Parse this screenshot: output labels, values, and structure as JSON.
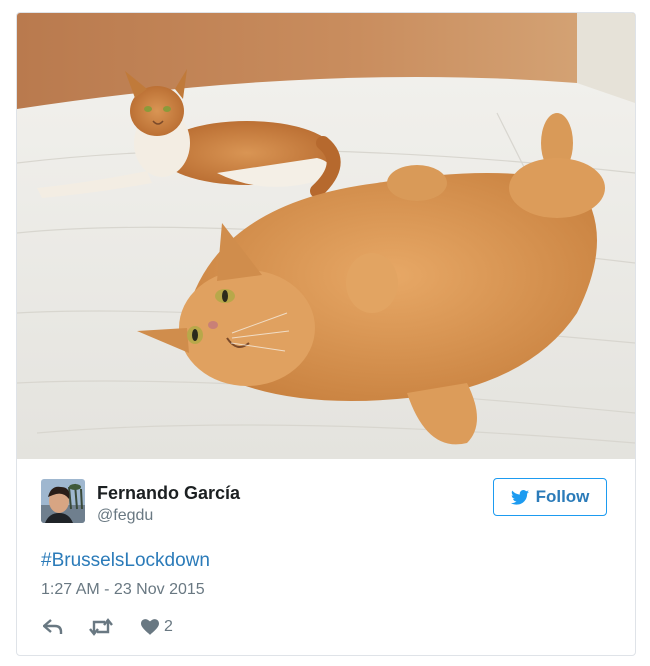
{
  "photo": {
    "subject": "two orange tabby cats lying on a white bed"
  },
  "author": {
    "name": "Fernando García",
    "handle": "@fegdu",
    "avatar_icon": "user-avatar"
  },
  "follow_button": {
    "label": "Follow",
    "icon": "twitter-bird-icon"
  },
  "tweet": {
    "hashtag": "#BrusselsLockdown",
    "timestamp": "1:27 AM - 23 Nov 2015"
  },
  "actions": {
    "reply_icon": "reply-icon",
    "retweet_icon": "retweet-icon",
    "like_icon": "heart-icon",
    "like_count": "2"
  },
  "colors": {
    "accent": "#2b7bb9",
    "text_primary": "#1c2022",
    "text_secondary": "#697882",
    "border": "#dfe3e8"
  }
}
